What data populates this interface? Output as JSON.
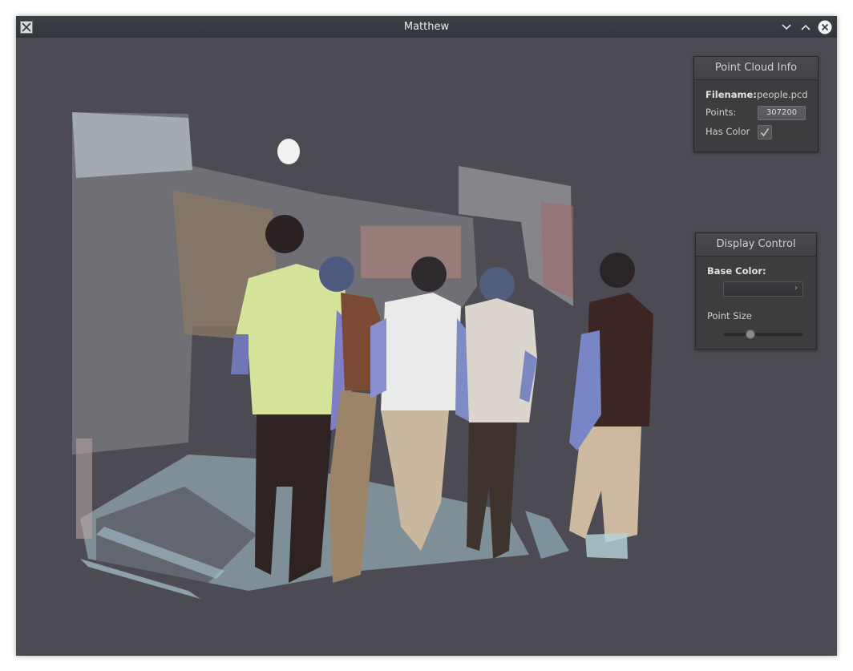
{
  "window": {
    "title": "Matthew",
    "icons": [
      "x-app-icon",
      "minimize-icon",
      "maximize-icon",
      "close-icon"
    ]
  },
  "viewport": {
    "content": "point-cloud-render",
    "background_color": "#4c4b53"
  },
  "point_cloud_info": {
    "title": "Point Cloud Info",
    "filename_label": "Filename:",
    "filename_value": "people.pcd",
    "points_label": "Points:",
    "points_value": "307200",
    "has_color_label": "Has Color",
    "has_color_checked": true
  },
  "display_control": {
    "title": "Display Control",
    "base_color_label": "Base Color:",
    "base_color_button": "›",
    "point_size_label": "Point Size",
    "point_size_value": 0.33
  }
}
